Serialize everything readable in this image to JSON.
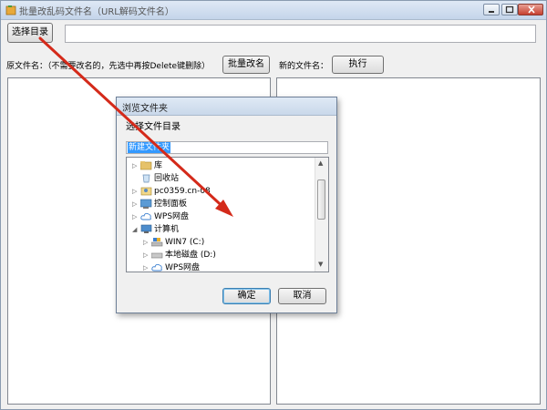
{
  "window": {
    "title": "批量改乱码文件名（URL解码文件名）"
  },
  "toolbar": {
    "select_dir_label": "选择目录",
    "path_value": "",
    "original_label": "原文件名：（不需要改名的，先选中再按Delete键删除）",
    "batch_rename_label": "批量改名",
    "new_name_label": "新的文件名：",
    "execute_label": "执行"
  },
  "dialog": {
    "title": "浏览文件夹",
    "subtitle": "选择文件目录",
    "selected_path": "新建文件夹",
    "ok_label": "确定",
    "cancel_label": "取消",
    "tree": [
      {
        "label": "库",
        "icon": "library-icon"
      },
      {
        "label": "回收站",
        "icon": "recycle-bin-icon"
      },
      {
        "label": "pc0359.cn-08",
        "icon": "user-folder-icon"
      },
      {
        "label": "控制面板",
        "icon": "control-panel-icon"
      },
      {
        "label": "WPS网盘",
        "icon": "cloud-icon"
      },
      {
        "label": "计算机",
        "icon": "computer-icon"
      },
      {
        "label": "WIN7 (C:)",
        "icon": "system-drive-icon"
      },
      {
        "label": "本地磁盘 (D:)",
        "icon": "drive-icon"
      },
      {
        "label": "WPS网盘",
        "icon": "cloud-icon"
      }
    ]
  },
  "colors": {
    "annotation_arrow": "#d42a1a",
    "selection": "#3399ff"
  }
}
